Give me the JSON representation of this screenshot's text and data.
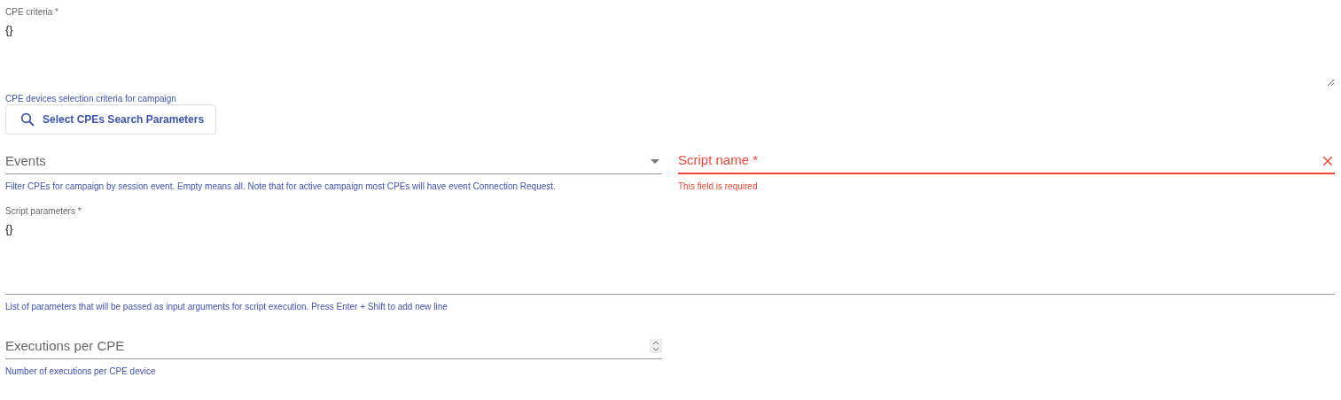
{
  "cpe_criteria": {
    "label": "CPE criteria *",
    "value": "{}",
    "hint": "CPE devices selection criteria for campaign"
  },
  "search_button": {
    "label": "Select CPEs Search Parameters"
  },
  "events": {
    "placeholder": "Events",
    "hint": "Filter CPEs for campaign by session event. Empty means all. Note that for active campaign most CPEs will have event Connection Request."
  },
  "script_name": {
    "placeholder": "Script name *",
    "invalid": true,
    "error": "This field is required"
  },
  "script_parameters": {
    "label": "Script parameters *",
    "value": "{}",
    "hint": "List of parameters that will be passed as input arguments for script execution. Press Enter + Shift to add new line"
  },
  "executions_per_cpe": {
    "placeholder": "Executions per CPE",
    "hint": "Number of executions per CPE device"
  }
}
